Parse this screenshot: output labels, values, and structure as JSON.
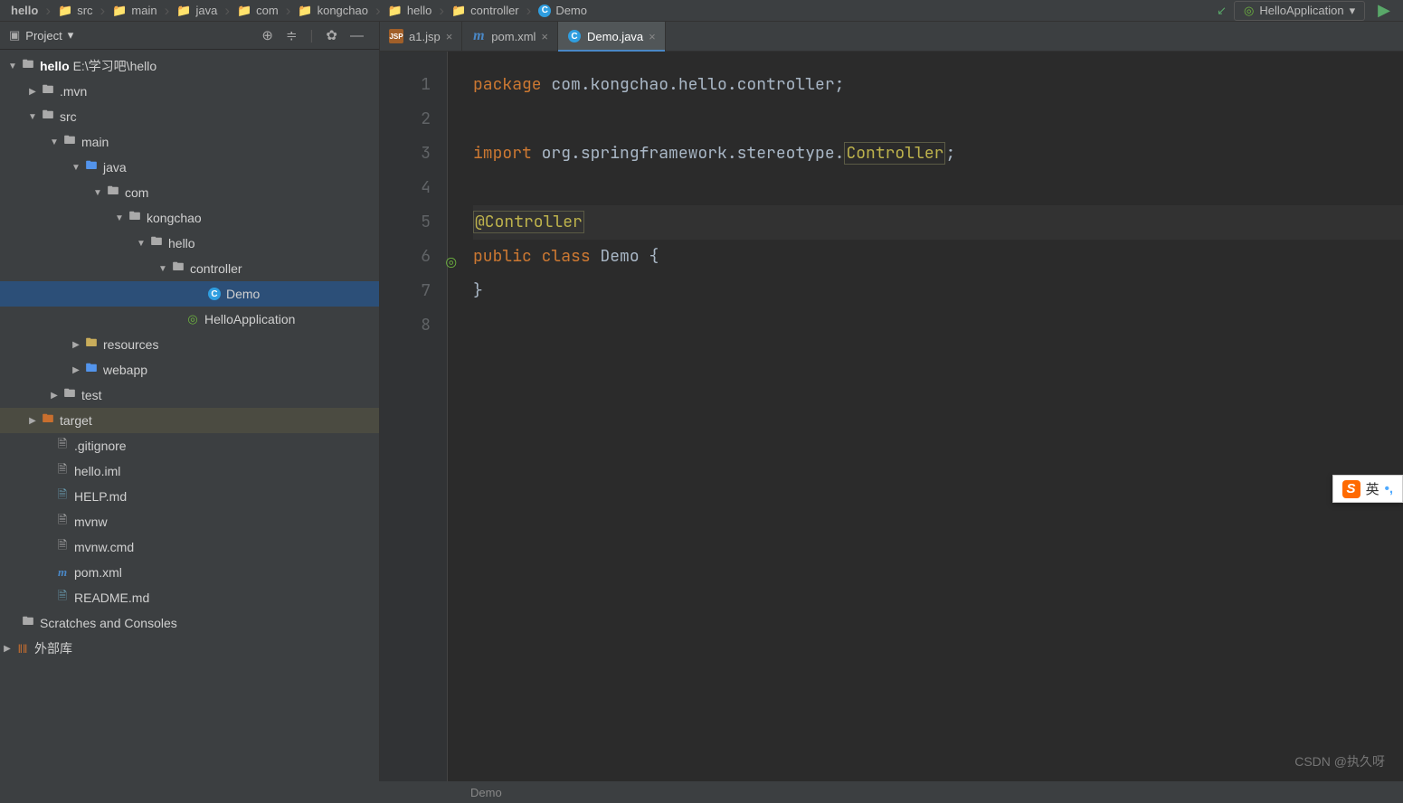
{
  "breadcrumbs": [
    "hello",
    "src",
    "main",
    "java",
    "com",
    "kongchao",
    "hello",
    "controller",
    "Demo"
  ],
  "run_config": {
    "label": "HelloApplication"
  },
  "sidebar": {
    "title": "Project",
    "root_label": "hello",
    "root_path": "E:\\学习吧\\hello",
    "nodes": {
      "mvn": ".mvn",
      "src": "src",
      "main": "main",
      "java": "java",
      "com": "com",
      "kongchao": "kongchao",
      "hello": "hello",
      "controller": "controller",
      "demo": "Demo",
      "helloapp": "HelloApplication",
      "resources": "resources",
      "webapp": "webapp",
      "test": "test",
      "target": "target",
      "gitignore": ".gitignore",
      "helloiml": "hello.iml",
      "helpmd": "HELP.md",
      "mvnw": "mvnw",
      "mvnwcmd": "mvnw.cmd",
      "pomxml": "pom.xml",
      "readme": "README.md",
      "scratches": "Scratches and Consoles",
      "extlib": "外部库"
    }
  },
  "tabs": [
    {
      "label": "a1.jsp"
    },
    {
      "label": "pom.xml"
    },
    {
      "label": "Demo.java"
    }
  ],
  "code": {
    "line_numbers": [
      "1",
      "2",
      "3",
      "4",
      "5",
      "6",
      "7",
      "8"
    ],
    "t": {
      "package": "package",
      "pkgname": "com.kongchao.hello.controller",
      "import": "import",
      "importref": "org.springframework.stereotype.",
      "controller": "Controller",
      "ann": "@Controller",
      "public": "public",
      "class": "class",
      "demo": "Demo",
      "brace_open": "{",
      "brace_close": "}",
      "semi": ";"
    }
  },
  "status": {
    "context": "Demo"
  },
  "watermark": "CSDN @执久呀",
  "ime": {
    "char": "英"
  }
}
